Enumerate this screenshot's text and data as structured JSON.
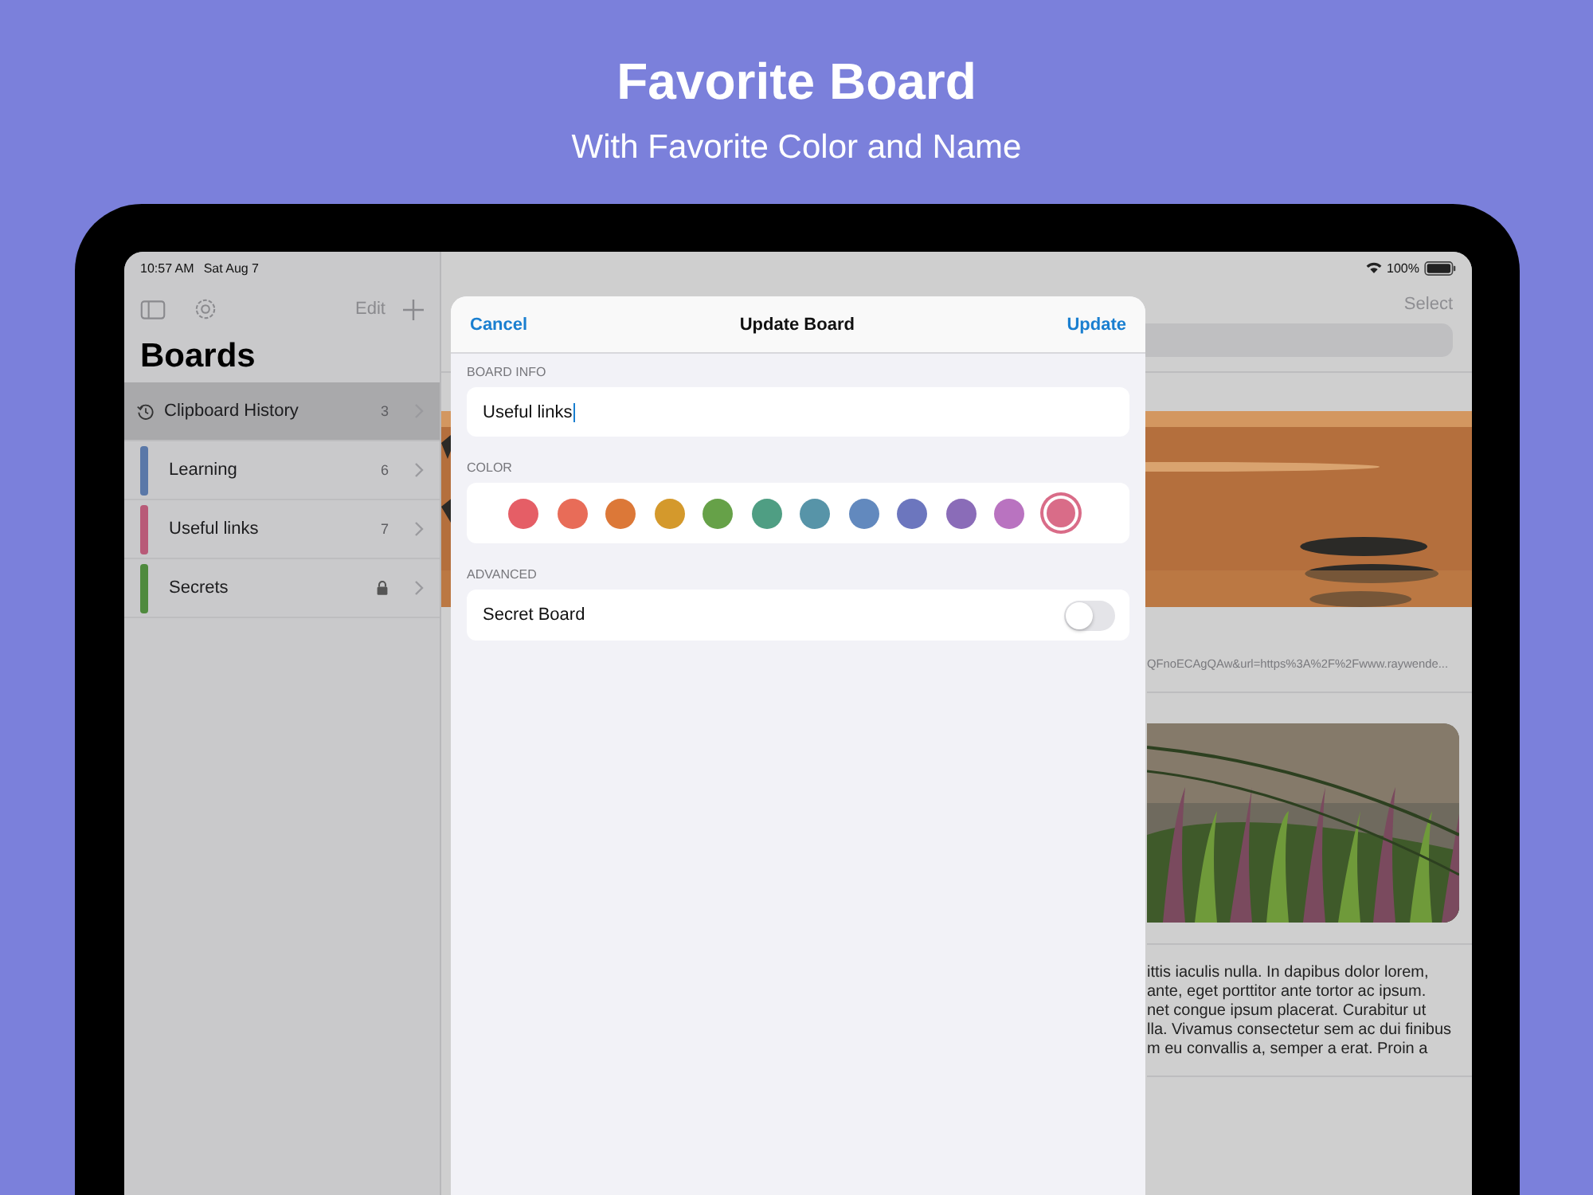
{
  "header": {
    "title": "Favorite Board",
    "subtitle": "With Favorite Color and Name"
  },
  "status_bar": {
    "time": "10:57 AM",
    "date": "Sat Aug 7",
    "battery": "100%"
  },
  "sidebar": {
    "edit": "Edit",
    "title": "Boards",
    "items": [
      {
        "kind": "history",
        "label": "Clipboard History",
        "count": "3",
        "selected": true
      },
      {
        "kind": "board",
        "label": "Learning",
        "count": "6",
        "color": "#5a78a8",
        "selected": false
      },
      {
        "kind": "board",
        "label": "Useful links",
        "count": "7",
        "color": "#b85a78",
        "selected": false
      },
      {
        "kind": "locked",
        "label": "Secrets",
        "color": "#4f8a3e",
        "selected": false
      }
    ]
  },
  "detail": {
    "select": "Select",
    "url": "QFnoECAgQAw&url=https%3A%2F%2Fwww.raywende...",
    "lines": [
      "ittis iaculis nulla. In dapibus dolor lorem,",
      "ante, eget porttitor ante tortor ac ipsum.",
      "net congue ipsum placerat. Curabitur ut",
      "lla. Vivamus consectetur sem ac dui finibus",
      "m eu convallis a, semper a erat. Proin a"
    ]
  },
  "sheet": {
    "cancel": "Cancel",
    "title": "Update Board",
    "confirm": "Update",
    "name_label": "BOARD INFO",
    "name_value": "Useful links",
    "color_label": "COLOR",
    "colors": [
      {
        "color": "#e55e66",
        "selected": false
      },
      {
        "color": "#e86c58",
        "selected": false
      },
      {
        "color": "#dc7838",
        "selected": false
      },
      {
        "color": "#d4992c",
        "selected": false
      },
      {
        "color": "#66a148",
        "selected": false
      },
      {
        "color": "#4f9e83",
        "selected": false
      },
      {
        "color": "#5794a8",
        "selected": false
      },
      {
        "color": "#6289be",
        "selected": false
      },
      {
        "color": "#6c76be",
        "selected": false
      },
      {
        "color": "#8a6cb8",
        "selected": false
      },
      {
        "color": "#b973c0",
        "selected": false
      },
      {
        "color": "#d96c88",
        "selected": true
      }
    ],
    "advanced_label": "ADVANCED",
    "secret_label": "Secret Board",
    "secret_on": false
  }
}
